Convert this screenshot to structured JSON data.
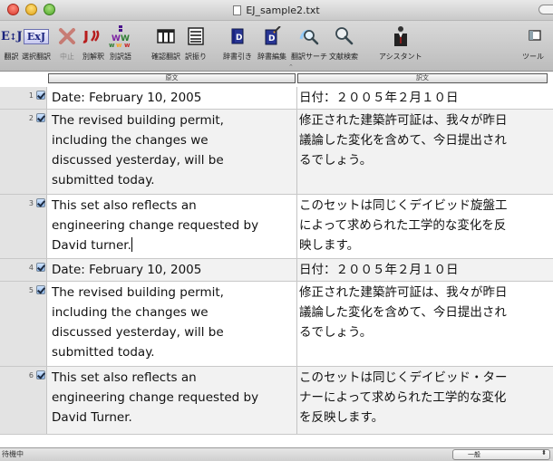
{
  "window": {
    "title": "EJ_sample2.txt"
  },
  "toolbar": {
    "items": [
      {
        "label": "翻訳",
        "icon": "ej-translate-icon"
      },
      {
        "label": "選択翻訳",
        "icon": "ej-select-translate-icon"
      },
      {
        "label": "中止",
        "icon": "stop-x-icon"
      },
      {
        "label": "別解釈",
        "icon": "alt-interpretation-icon"
      },
      {
        "label": "別訳語",
        "icon": "alt-word-icon"
      },
      {
        "label": "確認翻訳",
        "icon": "verify-columns-icon"
      },
      {
        "label": "訳振り",
        "icon": "interlinear-icon"
      },
      {
        "label": "辞書引き",
        "icon": "dictionary-lookup-icon"
      },
      {
        "label": "辞書編集",
        "icon": "dictionary-edit-icon"
      },
      {
        "label": "翻訳サーチ",
        "icon": "translation-search-icon"
      },
      {
        "label": "文献検索",
        "icon": "document-search-icon"
      },
      {
        "label": "アシスタント",
        "icon": "assistant-icon"
      },
      {
        "label": "ツール",
        "icon": "tool-icon"
      }
    ]
  },
  "columns": {
    "source": "原文",
    "target": "訳文"
  },
  "rows": [
    {
      "num": "1",
      "checked": true,
      "src": [
        "Date: February 10, 2005"
      ],
      "tgt": [
        "日付：２００５年２月１０日"
      ]
    },
    {
      "num": "2",
      "checked": true,
      "src": [
        "The revised building permit,",
        "including the changes we",
        "discussed yesterday, will be",
        "submitted today."
      ],
      "tgt": [
        "修正された建築許可証は、我々が昨日",
        "議論した変化を含めて、今日提出され",
        "るでしょう。"
      ]
    },
    {
      "num": "3",
      "checked": true,
      "src": [
        "This set also reflects an",
        "engineering change requested by",
        "David turner."
      ],
      "tgt": [
        "このセットは同じくデイビッド旋盤工",
        "によって求められた工学的な変化を反",
        "映します。"
      ]
    },
    {
      "num": "4",
      "checked": true,
      "src": [
        "Date: February 10, 2005"
      ],
      "tgt": [
        "日付：２００５年２月１０日"
      ]
    },
    {
      "num": "5",
      "checked": true,
      "src": [
        "The revised building permit,",
        "including the changes we",
        "discussed yesterday, will be",
        "submitted today."
      ],
      "tgt": [
        "修正された建築許可証は、我々が昨日",
        "議論した変化を含めて、今日提出され",
        "るでしょう。"
      ]
    },
    {
      "num": "6",
      "checked": true,
      "src": [
        "This set also reflects an",
        "engineering change requested by",
        "David Turner."
      ],
      "tgt": [
        "このセットは同じくデイビッド・ター",
        "ナーによって求められた工学的な変化",
        "を反映します。"
      ]
    }
  ],
  "status": {
    "text": "待機中",
    "mode": "一般"
  }
}
